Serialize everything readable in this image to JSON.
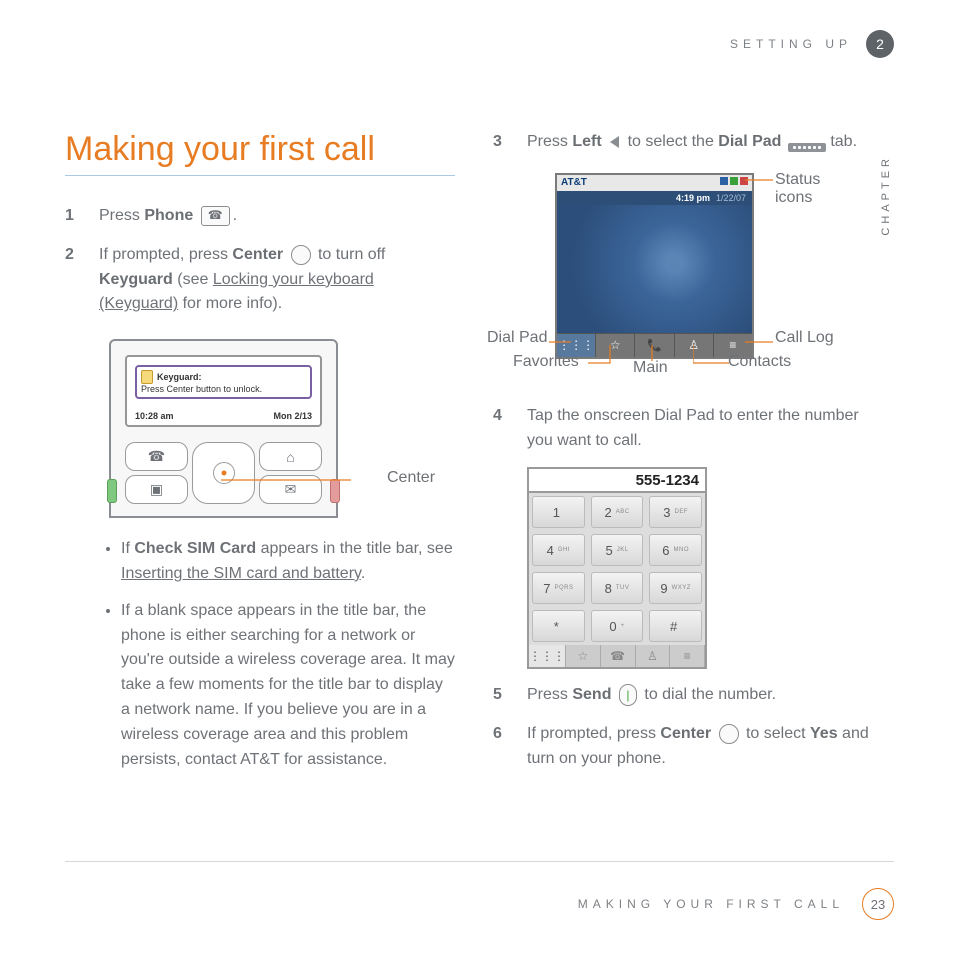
{
  "header": {
    "section": "SETTING UP",
    "chapter_num": "2",
    "chapter_word": "CHAPTER"
  },
  "title": "Making your first call",
  "left": {
    "step1": {
      "pre": "Press ",
      "b": "Phone",
      "post": " ",
      "end": "."
    },
    "step2": {
      "pre": "If prompted, press ",
      "b1": "Center",
      "mid": " ",
      "mid2": " to turn off ",
      "b2": "Keyguard",
      "post": " (see ",
      "link": "Locking your keyboard (Keyguard)",
      "end": " for more info)."
    },
    "fig1": {
      "kg_title": "Keyguard:",
      "kg_sub": "Press Center button to unlock.",
      "time": "10:28 am",
      "date": "Mon 2/13",
      "callout": "Center"
    },
    "bul1": {
      "pre": "If ",
      "b": "Check SIM Card",
      "mid": " appears in the title bar, see ",
      "link": "Inserting the SIM card and battery",
      "end": "."
    },
    "bul2": "If a blank space appears in the title bar, the phone is either searching for a network or you're outside a wireless coverage area. It may take a few moments for the title bar to display a network name. If you believe you are in a wireless coverage area and this problem persists, contact AT&T for assistance."
  },
  "right": {
    "step3": {
      "pre": "Press ",
      "b1": "Left",
      "mid": " ",
      "mid2": " to select the ",
      "b2": "Dial Pad",
      "post": " ",
      "end": " tab."
    },
    "fig2": {
      "carrier": "AT&T",
      "time": "4:19 pm",
      "date": "1/22/07",
      "callouts": {
        "status": "Status icons",
        "dialpad": "Dial Pad",
        "favorites": "Favorites",
        "main": "Main",
        "contacts": "Contacts",
        "calllog": "Call Log"
      }
    },
    "step4": "Tap the onscreen Dial Pad to enter the number you want to call.",
    "dp_display": "555-1234",
    "dp": [
      [
        "1",
        ""
      ],
      [
        "2",
        "ABC"
      ],
      [
        "3",
        "DEF"
      ],
      [
        "4",
        "GHI"
      ],
      [
        "5",
        "JKL"
      ],
      [
        "6",
        "MNO"
      ],
      [
        "7",
        "PQRS"
      ],
      [
        "8",
        "TUV"
      ],
      [
        "9",
        "WXYZ"
      ],
      [
        "*",
        ""
      ],
      [
        "0",
        "+"
      ],
      [
        "#",
        ""
      ]
    ],
    "step5": {
      "pre": "Press ",
      "b": "Send",
      "mid": " ",
      "end": " to dial the number."
    },
    "step6": {
      "pre": "If prompted, press ",
      "b1": "Center",
      "mid": " ",
      "mid2": " to select ",
      "b2": "Yes",
      "end": " and turn on your phone."
    }
  },
  "footer": {
    "text": "MAKING YOUR FIRST CALL",
    "page": "23"
  }
}
